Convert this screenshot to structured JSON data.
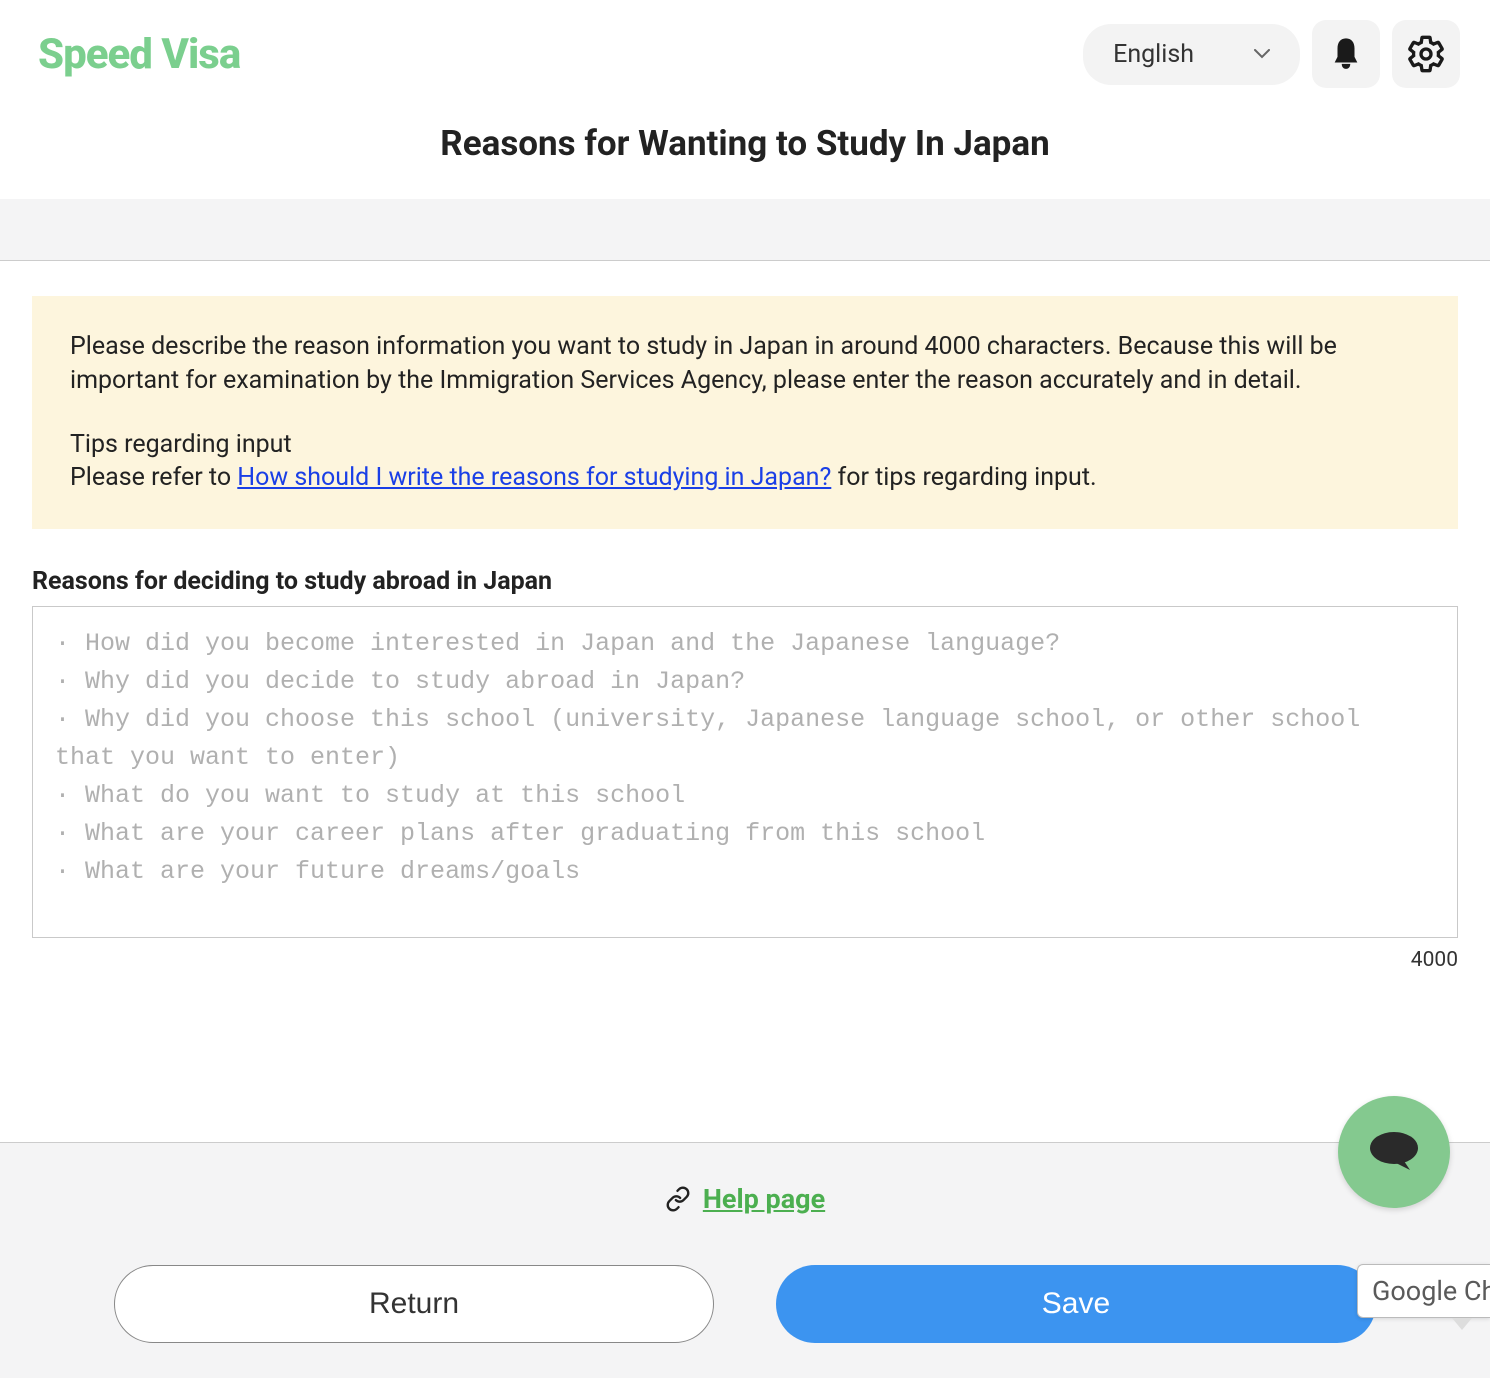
{
  "header": {
    "logo": "Speed Visa",
    "language_selected": "English"
  },
  "page_title": "Reasons for Wanting to Study In Japan",
  "info": {
    "paragraph1": "Please describe the reason information you want to study in Japan in around 4000 characters. Because this will be important for examination by the Immigration Services Agency, please enter the reason accurately and in detail.",
    "tips_heading": "Tips regarding input",
    "tips_prefix": "Please refer to ",
    "tips_link_text": "How should I write the reasons for studying in Japan?",
    "tips_suffix": " for tips regarding input."
  },
  "form": {
    "label": "Reasons for deciding to study abroad in Japan",
    "placeholder": "· How did you become interested in Japan and the Japanese language?\n· Why did you decide to study abroad in Japan?\n· Why did you choose this school (university, Japanese language school, or other school that you want to enter)\n· What do you want to study at this school\n· What are your career plans after graduating from this school\n· What are your future dreams/goals",
    "value": "",
    "char_limit": "4000"
  },
  "footer": {
    "help_link": "Help page",
    "return_button": "Return",
    "save_button": "Save"
  },
  "misc": {
    "translate_badge": "Google Ch"
  }
}
